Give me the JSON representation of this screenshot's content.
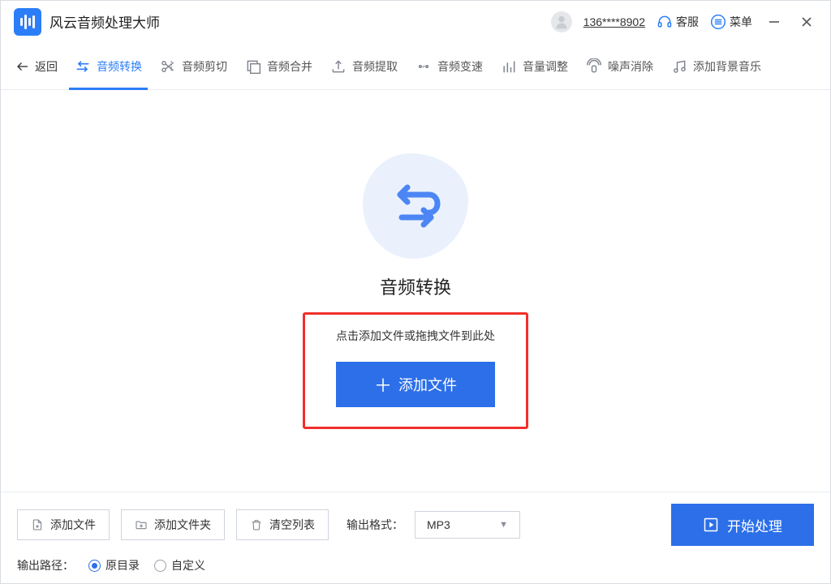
{
  "titlebar": {
    "app_name": "风云音频处理大师",
    "phone": "136****8902",
    "support_label": "客服",
    "menu_label": "菜单"
  },
  "toolbar": {
    "back_label": "返回",
    "tabs": [
      {
        "label": "音频转换"
      },
      {
        "label": "音频剪切"
      },
      {
        "label": "音频合并"
      },
      {
        "label": "音频提取"
      },
      {
        "label": "音频变速"
      },
      {
        "label": "音量调整"
      },
      {
        "label": "噪声消除"
      },
      {
        "label": "添加背景音乐"
      }
    ]
  },
  "main": {
    "title": "音频转换",
    "drop_hint": "点击添加文件或拖拽文件到此处",
    "add_file_label": "添加文件"
  },
  "bottom": {
    "add_file": "添加文件",
    "add_folder": "添加文件夹",
    "clear_list": "清空列表",
    "output_format_label": "输出格式：",
    "output_format_value": "MP3",
    "start_label": "开始处理",
    "output_path_label": "输出路径：",
    "radio_original": "原目录",
    "radio_custom": "自定义",
    "radio_selected": "original"
  }
}
